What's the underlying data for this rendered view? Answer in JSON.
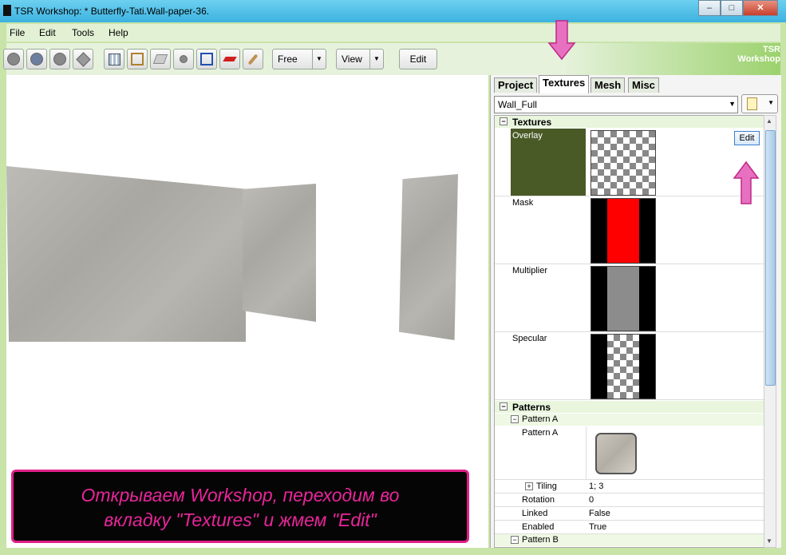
{
  "window": {
    "title": "TSR Workshop: * Butterfly-Tati.Wall-paper-36.",
    "min": "–",
    "max": "□",
    "close": "✕"
  },
  "menu": [
    "File",
    "Edit",
    "Tools",
    "Help"
  ],
  "toolbar": {
    "mode_value": "Free",
    "view_value": "View",
    "edit_label": "Edit",
    "logo": "TSR Workshop"
  },
  "panel": {
    "tabs": [
      "Project",
      "Textures",
      "Mesh",
      "Misc"
    ],
    "active_tab": "Textures",
    "selector_value": "Wall_Full",
    "textures_section": "Textures",
    "overlay_label": "Overlay",
    "overlay_edit": "Edit",
    "mask_label": "Mask",
    "multiplier_label": "Multiplier",
    "specular_label": "Specular",
    "patterns_section": "Patterns",
    "pattern_a_group": "Pattern A",
    "pattern_a_label": "Pattern A",
    "tiling_label": "Tiling",
    "tiling_value": "1; 3",
    "rotation_label": "Rotation",
    "rotation_value": "0",
    "linked_label": "Linked",
    "linked_value": "False",
    "enabled_label": "Enabled",
    "enabled_value": "True",
    "pattern_b_group": "Pattern B"
  },
  "caption": {
    "line1": "Открываем Workshop, переходим во",
    "line2": "вкладку \"Textures\" и жмем \"Edit\""
  },
  "colors": {
    "accent_pink": "#e0208a",
    "overlay_swatch": "#4a5a27",
    "mask_red": "#ff0000"
  }
}
